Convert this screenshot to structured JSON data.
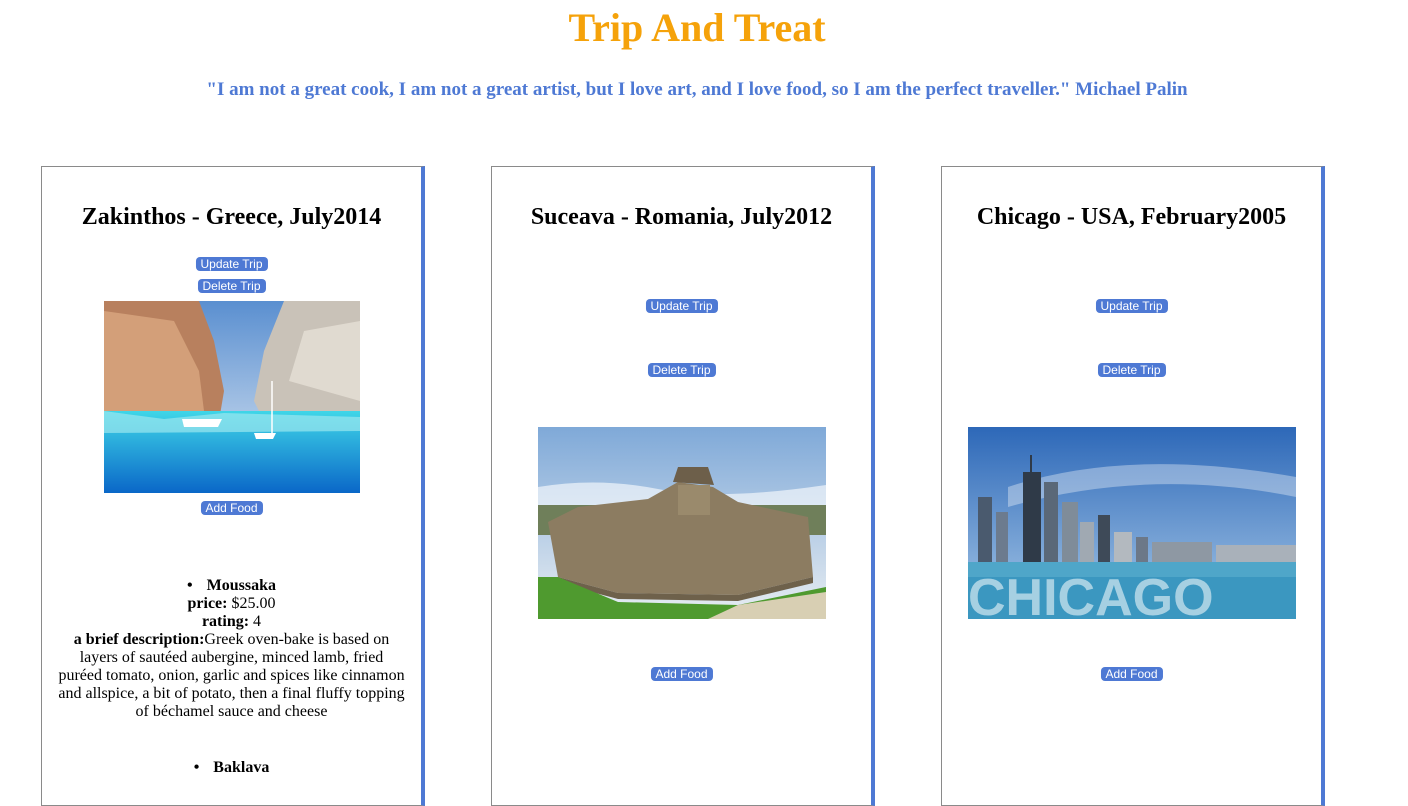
{
  "header": {
    "title": "Trip And Treat",
    "quote": "\"I am not a great cook, I am not a great artist, but I love art, and I love food, so I am the perfect traveller.\" Michael Palin"
  },
  "colors": {
    "title": "#f5a20a",
    "quote": "#4e79d4",
    "button": "#4e79d4",
    "card_border_accent": "#4e79d4"
  },
  "labels": {
    "update_trip": "Update Trip",
    "delete_trip": "Delete Trip",
    "add_food": "Add Food",
    "price": "price:",
    "rating": "rating:",
    "description": "a brief description:"
  },
  "trips": [
    {
      "title": "Zakinthos - Greece, July2014",
      "image": "zakynthos-shipwreck-beach-photo",
      "foods": [
        {
          "name": "Moussaka",
          "price": "$25.00",
          "rating": "4",
          "description": "Greek oven-bake is based on layers of sautéed aubergine, minced lamb, fried puréed tomato, onion, garlic and spices like cinnamon and allspice, a bit of potato, then a final fluffy topping of béchamel sauce and cheese"
        },
        {
          "name": "Baklava"
        }
      ]
    },
    {
      "title": "Suceava - Romania, July2012",
      "image": "suceava-fortress-photo",
      "foods": []
    },
    {
      "title": "Chicago - USA, February2005",
      "image": "chicago-skyline-photo",
      "image_text": "CHICAGO",
      "foods": []
    }
  ]
}
